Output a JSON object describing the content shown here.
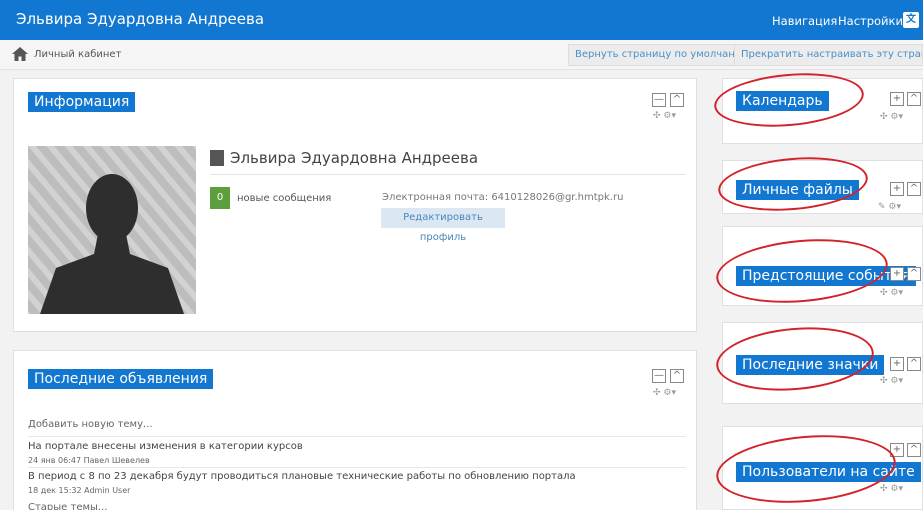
{
  "header": {
    "site_title": "Эльвира Эдуардовна Андреева",
    "nav_label": "Навигация",
    "settings_label": "Настройки",
    "lang_icon": "translate-icon"
  },
  "breadcrumb": {
    "home_icon": "home-icon",
    "item": "Личный кабинет",
    "reset_button": "Вернуть страницу по умолчанию",
    "stop_edit_button": "Прекратить настраивать эту страницу"
  },
  "info_block": {
    "title": "Информация",
    "user_name": "Эльвира Эдуардовна Андреева",
    "messages_count": "0",
    "messages_label": "новые сообщения",
    "email_text": "Электронная почта: 6410128026@gr.hmtpk.ru",
    "edit_profile_button": "Редактировать профиль"
  },
  "news_block": {
    "title": "Последние объявления",
    "add_topic": "Добавить новую тему...",
    "items": [
      {
        "title": "На портале внесены изменения в категории курсов",
        "meta": "24 янв 06:47  Павел Шевелев"
      },
      {
        "title": "В период с 8 по 23 декабря будут проводиться плановые технические работы по обновлению портала",
        "meta": "18 дек 15:32  Admin User"
      }
    ],
    "old_topics": "Старые темы..."
  },
  "side_blocks": [
    {
      "title": "Календарь"
    },
    {
      "title": "Личные файлы"
    },
    {
      "title": "Предстоящие события"
    },
    {
      "title": "Последние значки"
    },
    {
      "title": "Пользователи на сайте"
    }
  ],
  "controls": {
    "minus": "—",
    "plus": "+",
    "up": "^",
    "move_gear": "✣ ⚙▾",
    "edit_gear": "✎ ⚙▾"
  },
  "colors": {
    "brand": "#1177d1",
    "badge": "#5d9e3d",
    "annotation": "#d2232a"
  }
}
